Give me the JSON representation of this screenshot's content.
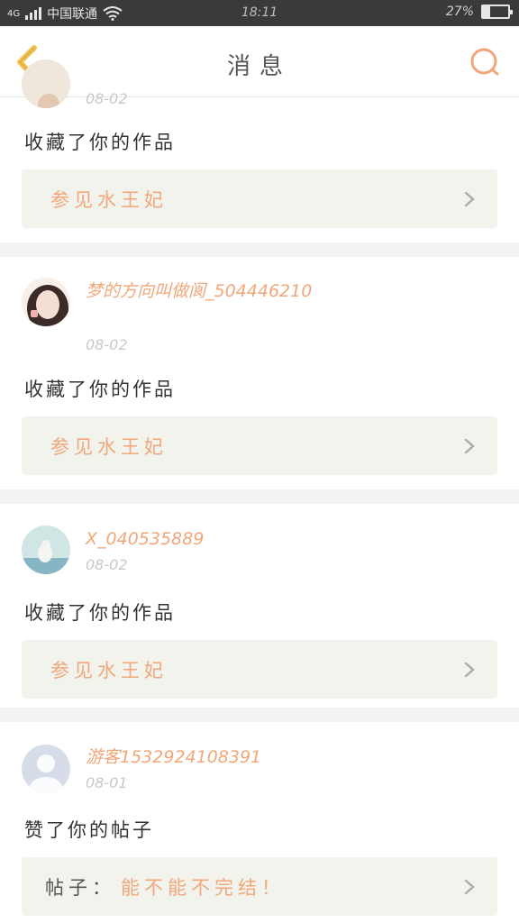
{
  "status_bar": {
    "carrier": "中国联通",
    "network": "4G",
    "time": "18:11",
    "battery_text": "27%",
    "battery_level": 0.27
  },
  "nav": {
    "title": "消息",
    "back_icon": "chevron-left-icon",
    "search_icon": "search-icon",
    "accent_color": "#f0a77a"
  },
  "notifications": [
    {
      "user": "",
      "time": "08-02",
      "action": "收藏了你的作品",
      "work_prefix": "",
      "work_title": "参见水王妃"
    },
    {
      "user": "梦的方向叫做阆_504446210",
      "time": "08-02",
      "action": "收藏了你的作品",
      "work_prefix": "",
      "work_title": "参见水王妃"
    },
    {
      "user": "X_040535889",
      "time": "08-02",
      "action": "收藏了你的作品",
      "work_prefix": "",
      "work_title": "参见水王妃"
    },
    {
      "user": "游客1532924108391",
      "time": "08-01",
      "action": "赞了你的帖子",
      "work_prefix": "帖子：",
      "work_title": "能不能不完结！"
    }
  ]
}
